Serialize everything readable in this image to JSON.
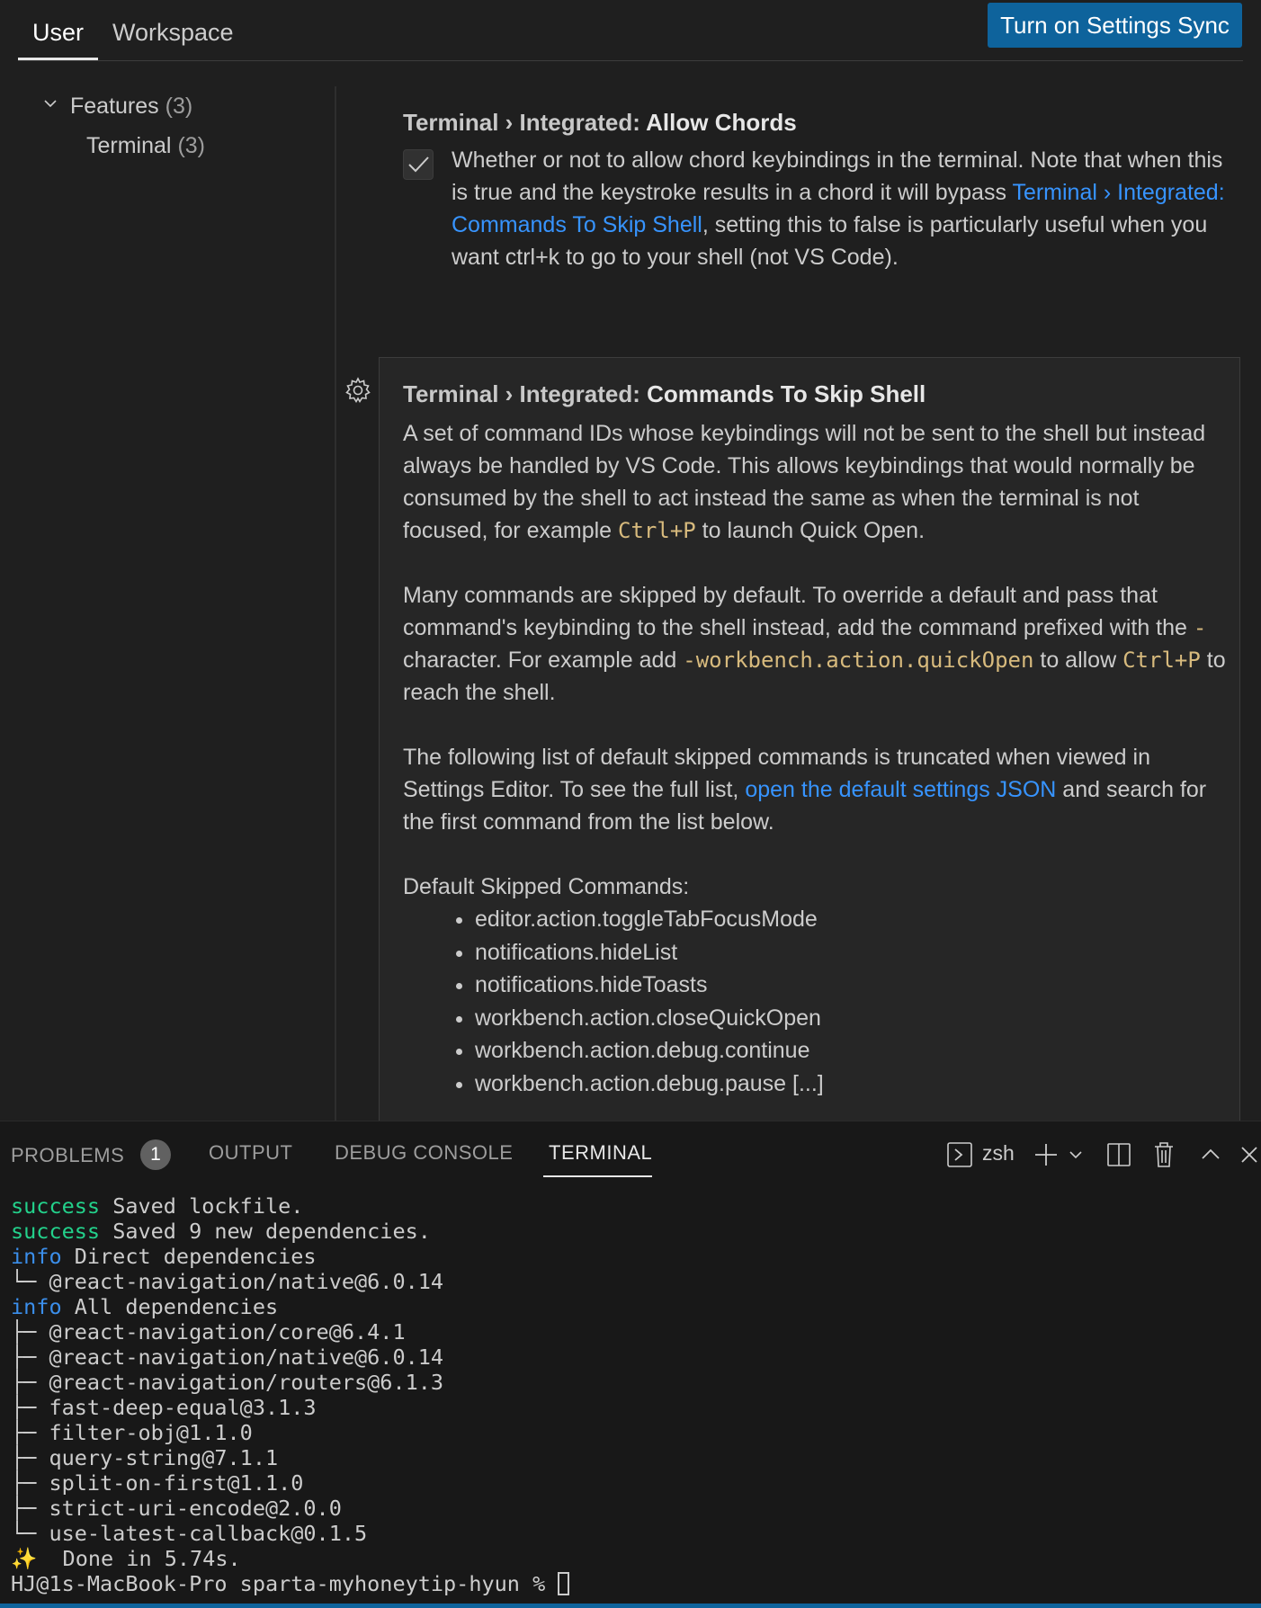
{
  "header": {
    "tabs": [
      "User",
      "Workspace"
    ],
    "sync_button": "Turn on Settings Sync"
  },
  "toc": {
    "features": {
      "label": "Features",
      "count": "(3)"
    },
    "terminal": {
      "label": "Terminal",
      "count": "(3)"
    }
  },
  "setting1": {
    "category": "Terminal › Integrated: ",
    "name": "Allow Chords",
    "checked": true,
    "desc_a": "Whether or not to allow chord keybindings in the terminal. Note that when this is true and the keystroke results in a chord it will bypass ",
    "desc_link": "Terminal › Integrated: Commands To Skip Shell",
    "desc_b": ", setting this to false is particularly useful when you want ctrl+k to go to your shell (not VS Code)."
  },
  "setting2": {
    "category": "Terminal › Integrated: ",
    "name": "Commands To Skip Shell",
    "p1_a": "A set of command IDs whose keybindings will not be sent to the shell but instead always be handled by VS Code. This allows keybindings that would normally be consumed by the shell to act instead the same as when the terminal is not focused, for example ",
    "p1_code": "Ctrl+P",
    "p1_b": " to launch Quick Open.",
    "p2_a": "Many commands are skipped by default. To override a default and pass that command's keybinding to the shell instead, add the command prefixed with the ",
    "p2_code1": "-",
    "p2_b": " character. For example add ",
    "p2_code2": "-workbench.action.quickOpen",
    "p2_c": " to allow ",
    "p2_code3": "Ctrl+P",
    "p2_d": " to reach the shell.",
    "p3_a": "The following list of default skipped commands is truncated when viewed in Settings Editor. To see the full list, ",
    "p3_link": "open the default settings JSON",
    "p3_b": " and search for the first command from the list below.",
    "list_title": "Default Skipped Commands:",
    "list": [
      "editor.action.toggleTabFocusMode",
      "notifications.hideList",
      "notifications.hideToasts",
      "workbench.action.closeQuickOpen",
      "workbench.action.debug.continue",
      "workbench.action.debug.pause [...]"
    ]
  },
  "panel": {
    "tabs": {
      "problems": "PROBLEMS",
      "problems_badge": "1",
      "output": "OUTPUT",
      "debug": "DEBUG CONSOLE",
      "terminal": "TERMINAL"
    },
    "shell": "zsh"
  },
  "terminal": {
    "lines": [
      {
        "kw": "success",
        "text": " Saved lockfile."
      },
      {
        "kw": "success",
        "text": " Saved 9 new dependencies."
      },
      {
        "kw": "info",
        "text": " Direct dependencies"
      },
      {
        "kw": "",
        "text": "└─ @react-navigation/native@6.0.14"
      },
      {
        "kw": "info",
        "text": " All dependencies"
      },
      {
        "kw": "",
        "text": "├─ @react-navigation/core@6.4.1"
      },
      {
        "kw": "",
        "text": "├─ @react-navigation/native@6.0.14"
      },
      {
        "kw": "",
        "text": "├─ @react-navigation/routers@6.1.3"
      },
      {
        "kw": "",
        "text": "├─ fast-deep-equal@3.1.3"
      },
      {
        "kw": "",
        "text": "├─ filter-obj@1.1.0"
      },
      {
        "kw": "",
        "text": "├─ query-string@7.1.1"
      },
      {
        "kw": "",
        "text": "├─ split-on-first@1.1.0"
      },
      {
        "kw": "",
        "text": "├─ strict-uri-encode@2.0.0"
      },
      {
        "kw": "",
        "text": "└─ use-latest-callback@0.1.5"
      },
      {
        "kw": "",
        "text": "✨  Done in 5.74s."
      }
    ],
    "prompt": "HJ@1s-MacBook-Pro sparta-myhoneytip-hyun % "
  },
  "colors": {
    "accent": "#0e639c",
    "link": "#3794ff",
    "code": "#d7ba7d",
    "success": "#23d18b",
    "info": "#3b8eea"
  }
}
